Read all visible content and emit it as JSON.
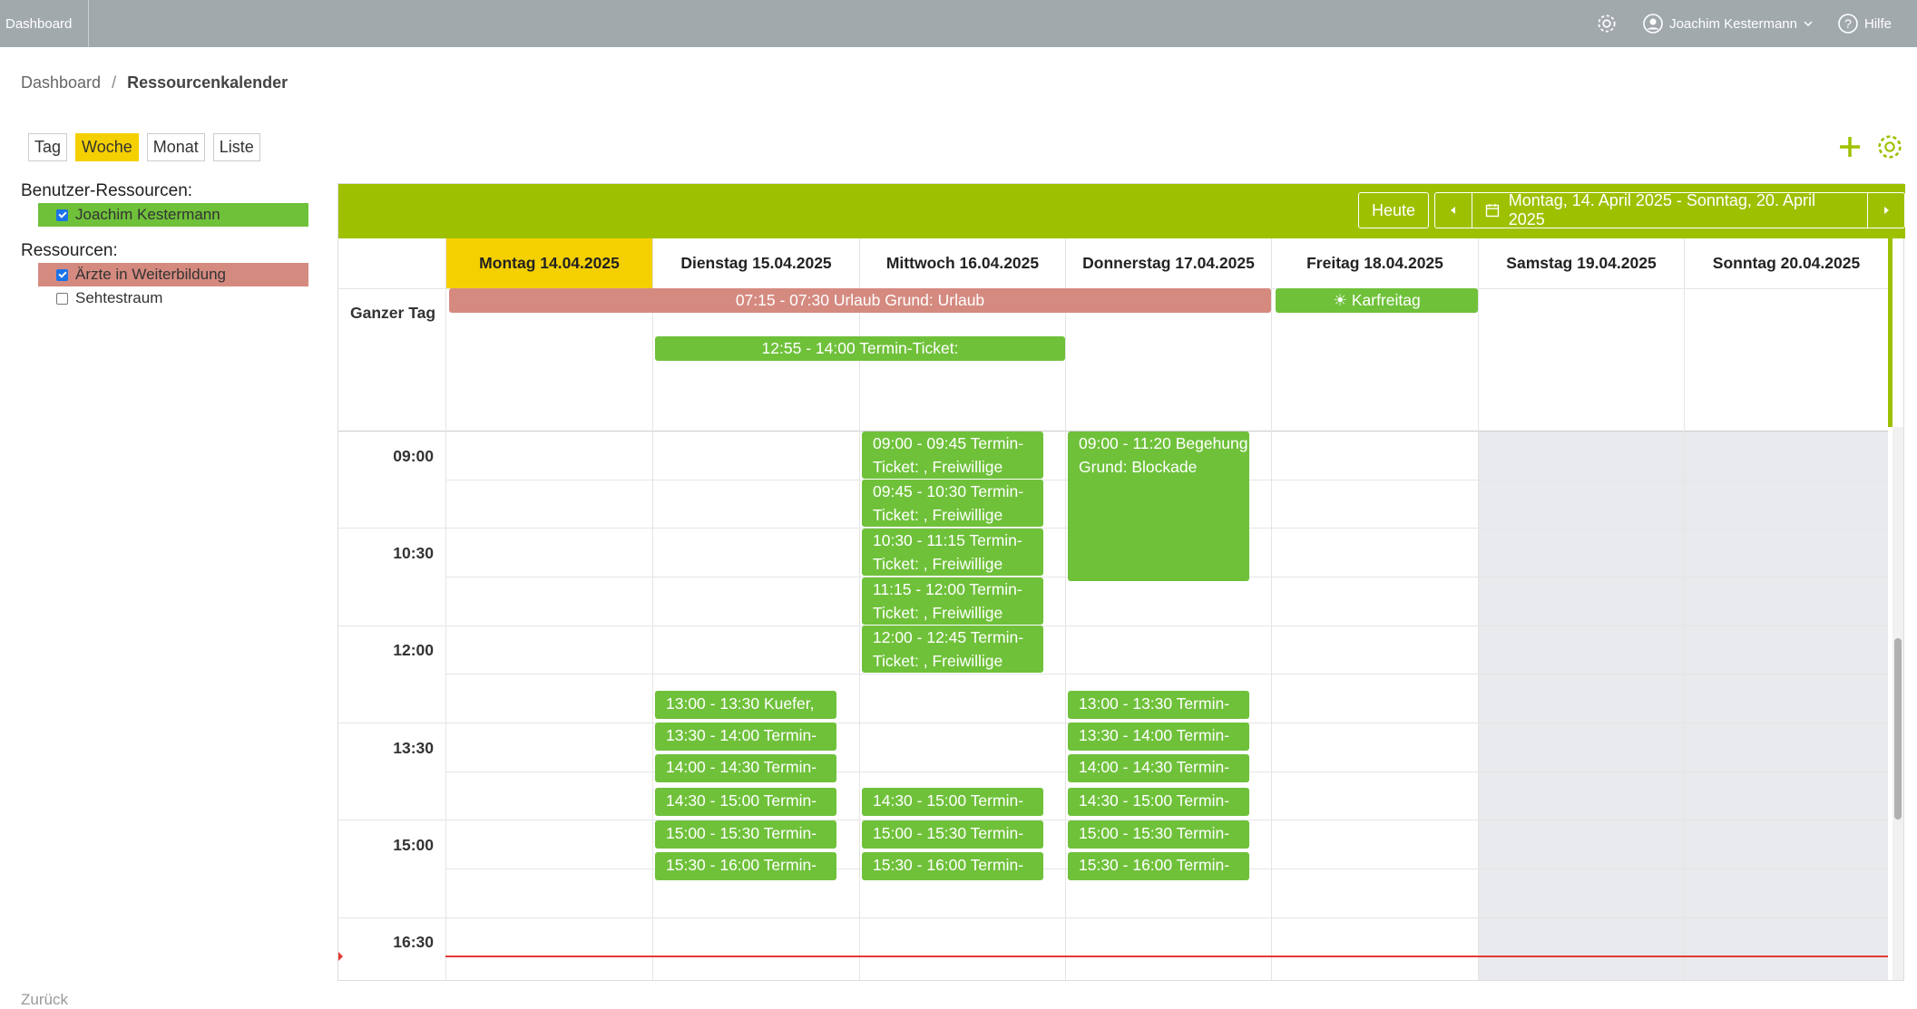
{
  "topbar": {
    "brand": "Dashboard",
    "user": "Joachim Kestermann",
    "help": "Hilfe",
    "icons": [
      "gear-icon",
      "user-icon",
      "chevron-down-icon",
      "help-icon"
    ]
  },
  "breadcrumb": {
    "root": "Dashboard",
    "separator": "/",
    "current": "Ressourcenkalender"
  },
  "views": [
    {
      "label": "Tag",
      "active": false
    },
    {
      "label": "Woche",
      "active": true
    },
    {
      "label": "Monat",
      "active": false
    },
    {
      "label": "Liste",
      "active": false
    }
  ],
  "sidebar": {
    "user_resources_title": "Benutzer-Ressourcen:",
    "user_resources": [
      {
        "label": "Joachim Kestermann",
        "checked": true,
        "color": "#6fc13a"
      }
    ],
    "resources_title": "Ressourcen:",
    "resources": [
      {
        "label": "Ärzte in Weiterbildung",
        "checked": true,
        "color": "#d58a80"
      },
      {
        "label": "Sehtestraum",
        "checked": false,
        "color": ""
      }
    ],
    "back": "Zurück"
  },
  "calendar": {
    "today_button": "Heute",
    "range": "Montag, 14. April 2025 - Sonntag, 20. April 2025",
    "days": [
      {
        "label": "Montag 14.04.2025",
        "today": true
      },
      {
        "label": "Dienstag 15.04.2025",
        "today": false
      },
      {
        "label": "Mittwoch 16.04.2025",
        "today": false
      },
      {
        "label": "Donnerstag 17.04.2025",
        "today": false
      },
      {
        "label": "Freitag 18.04.2025",
        "today": false
      },
      {
        "label": "Samstag 19.04.2025",
        "today": false
      },
      {
        "label": "Sonntag 20.04.2025",
        "today": false
      }
    ],
    "allday_label": "Ganzer Tag",
    "times": [
      "09:00",
      "10:30",
      "12:00",
      "13:30",
      "15:00",
      "16:30"
    ],
    "allday_events": {
      "urlaub": "07:15 - 07:30 Urlaub Grund: Urlaub",
      "karfreitag": "Karfreitag",
      "termin": "12:55 - 14:00 Termin-Ticket:"
    },
    "events": {
      "wed_0900": "09:00 - 09:45 Termin-Ticket: , Freiwillige",
      "wed_0945": "09:45 - 10:30 Termin-Ticket: , Freiwillige",
      "wed_1030": "10:30 - 11:15 Termin-Ticket: , Freiwillige",
      "wed_1115": "11:15 - 12:00 Termin-Ticket: , Freiwillige",
      "wed_1200": "12:00 - 12:45 Termin-Ticket: , Freiwillige",
      "thu_0900": "09:00 - 11:20 Begehung Grund: Blockade",
      "tue_1300": "13:00 - 13:30 Kuefer,",
      "tue_1330": "13:30 - 14:00 Termin-",
      "tue_1400": "14:00 - 14:30 Termin-",
      "tue_1430": "14:30 - 15:00 Termin-",
      "tue_1500": "15:00 - 15:30 Termin-",
      "tue_1530": "15:30 - 16:00 Termin-",
      "wed_1430": "14:30 - 15:00 Termin-",
      "wed_1500": "15:00 - 15:30 Termin-",
      "wed_1530": "15:30 - 16:00 Termin-",
      "thu_1300": "13:00 - 13:30 Termin-",
      "thu_1330": "13:30 - 14:00 Termin-",
      "thu_1400": "14:00 - 14:30 Termin-",
      "thu_1430": "14:30 - 15:00 Termin-",
      "thu_1500": "15:00 - 15:30 Termin-",
      "thu_1530": "15:30 - 16:00 Termin-"
    }
  },
  "colors": {
    "accent": "#9dc100",
    "event": "#6fc13a",
    "today": "#f5d000",
    "vacation": "#d58a80",
    "now": "#e53935"
  }
}
